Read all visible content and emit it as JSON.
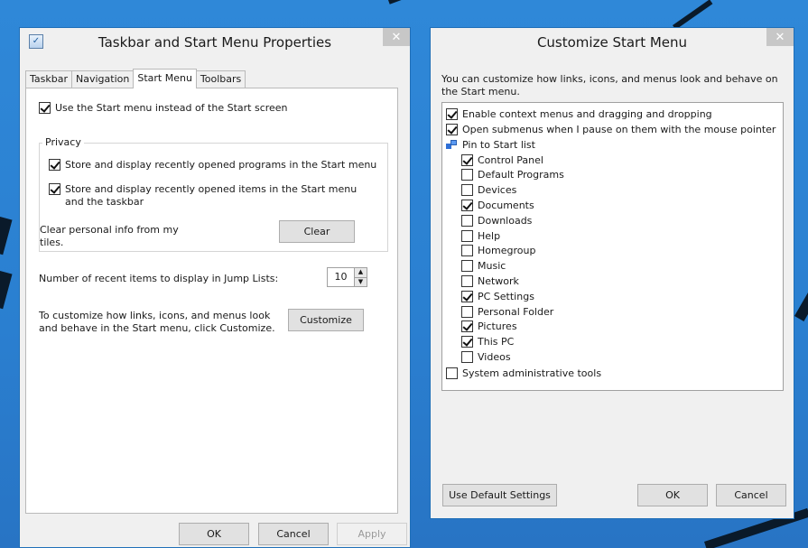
{
  "left_window": {
    "title": "Taskbar and Start Menu Properties",
    "close_glyph": "✕",
    "title_icon": "checkbox-document-icon",
    "tabs": [
      {
        "label": "Taskbar"
      },
      {
        "label": "Navigation"
      },
      {
        "label": "Start Menu",
        "active": true
      },
      {
        "label": "Toolbars"
      }
    ],
    "use_start_menu": {
      "label": "Use the Start menu instead of the Start screen",
      "checked": true
    },
    "privacy": {
      "legend": "Privacy",
      "store_programs": {
        "label": "Store and display recently opened programs in the Start menu",
        "checked": true
      },
      "store_items": {
        "label": "Store and display recently opened items in the Start menu and the taskbar",
        "checked": true
      },
      "clear_text": "Clear personal info from my tiles.",
      "clear_button": "Clear"
    },
    "jump_lists": {
      "label": "Number of recent items to display in Jump Lists:",
      "value": "10"
    },
    "customize": {
      "text": "To customize how links, icons, and menus look and behave in the Start menu, click Customize.",
      "button": "Customize"
    },
    "footer": {
      "ok": "OK",
      "cancel": "Cancel",
      "apply": "Apply"
    }
  },
  "right_window": {
    "title": "Customize Start Menu",
    "close_glyph": "✕",
    "description": "You can customize how links, icons, and menus look and behave on the Start menu.",
    "options": [
      {
        "label": "Enable context menus and dragging and dropping",
        "checked": true
      },
      {
        "label": "Open submenus when I pause on them with the mouse pointer",
        "checked": true
      }
    ],
    "pin_header": {
      "label": "Pin to Start list",
      "icon": "pin-icon"
    },
    "pin_items": [
      {
        "label": "Control Panel",
        "checked": true
      },
      {
        "label": "Default Programs",
        "checked": false
      },
      {
        "label": "Devices",
        "checked": false
      },
      {
        "label": "Documents",
        "checked": true
      },
      {
        "label": "Downloads",
        "checked": false
      },
      {
        "label": "Help",
        "checked": false
      },
      {
        "label": "Homegroup",
        "checked": false
      },
      {
        "label": "Music",
        "checked": false
      },
      {
        "label": "Network",
        "checked": false
      },
      {
        "label": "PC Settings",
        "checked": true
      },
      {
        "label": "Personal Folder",
        "checked": false
      },
      {
        "label": "Pictures",
        "checked": true
      },
      {
        "label": "This PC",
        "checked": true
      },
      {
        "label": "Videos",
        "checked": false
      }
    ],
    "system_tools": {
      "label": "System administrative tools",
      "checked": false
    },
    "footer": {
      "default": "Use Default Settings",
      "ok": "OK",
      "cancel": "Cancel"
    }
  },
  "colors": {
    "desktop": "#2a7fd0",
    "window": "#f0f0f0",
    "border": "#1f6fb8"
  }
}
